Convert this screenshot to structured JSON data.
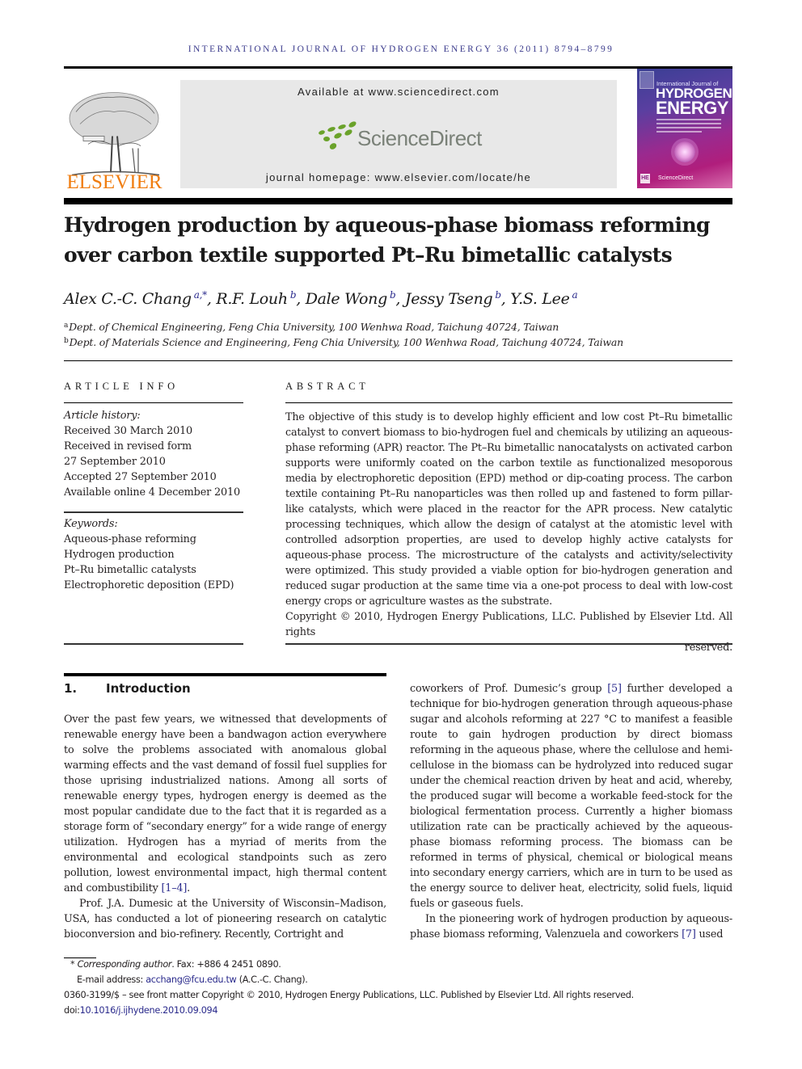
{
  "running_head": "INTERNATIONAL JOURNAL OF HYDROGEN ENERGY 36 (2011) 8794–8799",
  "publisher_logo": {
    "name": "ELSEVIER",
    "color": "#f07d10"
  },
  "sciencedirect": {
    "available_at": "Available at www.sciencedirect.com",
    "logo_text": "ScienceDirect",
    "logo_dot_color": "#6aa22a",
    "homepage": "journal homepage: www.elsevier.com/locate/he"
  },
  "cover": {
    "line1": "International Journal of",
    "line2": "HYDROGEN",
    "line3": "ENERGY",
    "badge": "HE",
    "footer": "ScienceDirect"
  },
  "article": {
    "title_line1": "Hydrogen production by aqueous-phase biomass reforming",
    "title_line2": "over carbon textile supported Pt–Ru bimetallic catalysts",
    "authors": [
      {
        "name": "Alex C.-C. Chang",
        "sup": "a,*",
        "sep": ", "
      },
      {
        "name": "R.F. Louh",
        "sup": "b",
        "sep": ", "
      },
      {
        "name": "Dale Wong",
        "sup": "b",
        "sep": ", "
      },
      {
        "name": "Jessy Tseng",
        "sup": "b",
        "sep": ", "
      },
      {
        "name": "Y.S. Lee",
        "sup": "a",
        "sep": ""
      }
    ],
    "affiliations": [
      {
        "sup": "a",
        "text": "Dept. of Chemical Engineering, Feng Chia University, 100 Wenhwa Road, Taichung 40724, Taiwan"
      },
      {
        "sup": "b",
        "text": "Dept. of Materials Science and Engineering, Feng Chia University, 100 Wenhwa Road, Taichung 40724, Taiwan"
      }
    ]
  },
  "article_info": {
    "heading": "ARTICLE INFO",
    "history_label": "Article history:",
    "history": [
      "Received 30 March 2010",
      "Received in revised form",
      "27 September 2010",
      "Accepted 27 September 2010",
      "Available online 4 December 2010"
    ],
    "keywords_label": "Keywords:",
    "keywords": [
      "Aqueous-phase reforming",
      "Hydrogen production",
      "Pt–Ru bimetallic catalysts",
      "Electrophoretic deposition (EPD)"
    ]
  },
  "abstract": {
    "heading": "ABSTRACT",
    "text": "The objective of this study is to develop highly efficient and low cost Pt–Ru bimetallic catalyst to convert biomass to bio-hydrogen fuel and chemicals by utilizing an aqueous-phase reforming (APR) reactor. The Pt–Ru bimetallic nanocatalysts on activated carbon supports were uniformly coated on the carbon textile as functionalized mesoporous media by electrophoretic deposition (EPD) method or dip-coating process. The carbon textile containing Pt–Ru nanoparticles was then rolled up and fastened to form pillar-like catalysts, which were placed in the reactor for the APR process. New catalytic processing techniques, which allow the design of catalyst at the atomistic level with controlled adsorption properties, are used to develop highly active catalysts for aqueous-phase process. The microstructure of the catalysts and activity/selectivity were optimized. This study provided a viable option for bio-hydrogen generation and reduced sugar production at the same time via a one-pot process to deal with low-cost energy crops or agriculture wastes as the substrate.",
    "copyright_line1": "Copyright © 2010, Hydrogen Energy Publications, LLC. Published by Elsevier Ltd. All rights",
    "copyright_line2": "reserved."
  },
  "introduction": {
    "number": "1.",
    "heading": "Introduction",
    "left_p1": "Over the past few years, we witnessed that developments of renewable energy have been a bandwagon action everywhere to solve the problems associated with anomalous global warming effects and the vast demand of fossil fuel supplies for those uprising industrialized nations. Among all sorts of renewable energy types, hydrogen energy is deemed as the most popular candidate due to the fact that it is regarded as a storage form of “secondary energy” for a wide range of energy utilization. Hydrogen has a myriad of merits from the environmental and ecological standpoints such as zero pollution, lowest environmental impact, high thermal content and combustibility ",
    "left_p1_ref": "[1–4]",
    "left_p1_end": ".",
    "left_p2": "Prof. J.A. Dumesic at the University of Wisconsin–Madison, USA, has conducted a lot of pioneering research on catalytic bioconversion and bio-refinery. Recently, Cortright and",
    "right_p1_a": "coworkers of Prof. Dumesic’s group ",
    "right_p1_ref": "[5]",
    "right_p1_b": " further developed a technique for bio-hydrogen generation through aqueous-phase sugar and alcohols reforming at 227 °C to manifest a feasible route to gain hydrogen production by direct biomass reforming in the aqueous phase, where the cellulose and hemi-cellulose in the biomass can be hydrolyzed into reduced sugar under the chemical reaction driven by heat and acid, whereby, the produced sugar will become a workable feed-stock for the biological fermentation process. Currently a higher biomass utilization rate can be practically achieved by the aqueous-phase biomass reforming process. The biomass can be reformed in terms of physical, chemical or biological means into secondary energy carriers, which are in turn to be used as the energy source to deliver heat, electricity, solid fuels, liquid fuels or gaseous fuels.",
    "right_p2_a": "In the pioneering work of hydrogen production by aqueous-phase biomass reforming, Valenzuela and coworkers ",
    "right_p2_ref": "[7]",
    "right_p2_b": " used"
  },
  "footnotes": {
    "corresponding_mark": "*",
    "corresponding_label": "Corresponding author",
    "fax": ". Fax: +886 4 2451 0890.",
    "email_label": "E-mail address: ",
    "email": "acchang@fcu.edu.tw",
    "email_suffix": " (A.C.-C. Chang).",
    "front_matter": "0360-3199/$ – see front matter Copyright © 2010, Hydrogen Energy Publications, LLC. Published by Elsevier Ltd. All rights reserved.",
    "doi_label": "doi:",
    "doi": "10.1016/j.ijhydene.2010.09.094"
  }
}
